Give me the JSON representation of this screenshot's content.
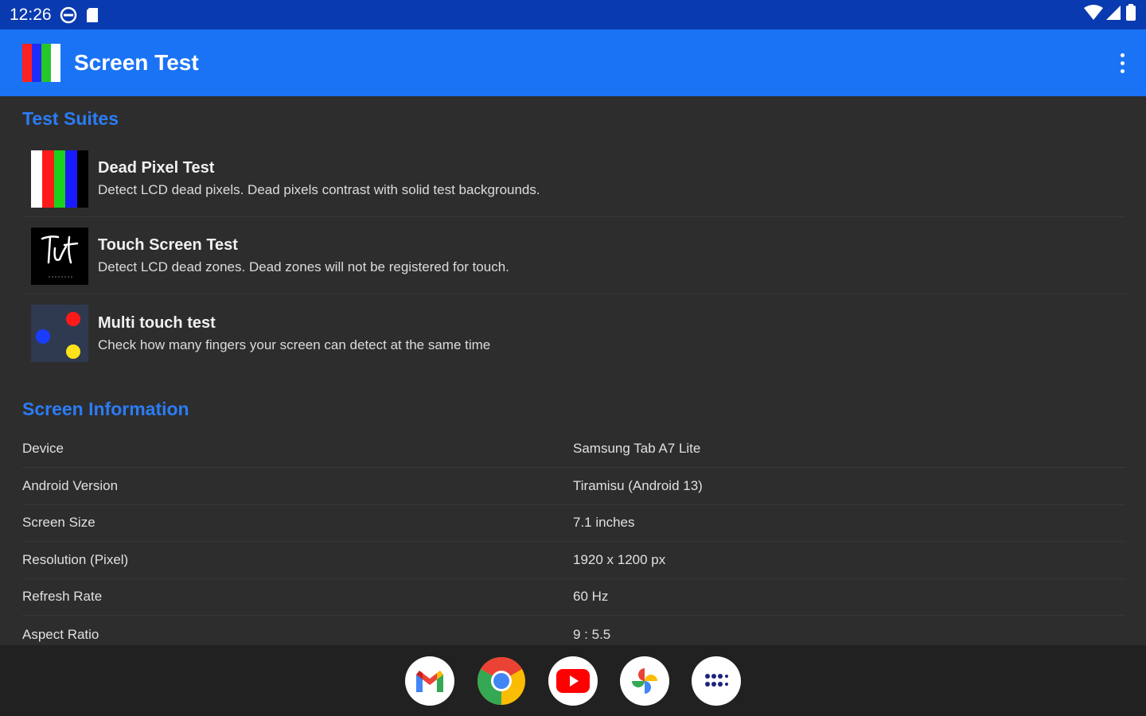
{
  "status_bar": {
    "time": "12:26"
  },
  "app_bar": {
    "title": "Screen Test"
  },
  "test_suites": {
    "title": "Test Suites",
    "items": [
      {
        "title": "Dead Pixel Test",
        "description": "Detect LCD dead pixels. Dead pixels contrast with solid test backgrounds."
      },
      {
        "title": "Touch Screen Test",
        "description": "Detect LCD dead zones. Dead zones will not be registered for touch."
      },
      {
        "title": "Multi touch test",
        "description": "Check how many fingers your screen can detect at the same time"
      }
    ]
  },
  "screen_information": {
    "title": "Screen Information",
    "rows": [
      {
        "label": "Device",
        "value": "Samsung Tab A7 Lite"
      },
      {
        "label": "Android Version",
        "value": "Tiramisu (Android 13)"
      },
      {
        "label": "Screen Size",
        "value": "7.1 inches"
      },
      {
        "label": "Resolution (Pixel)",
        "value": "1920 x 1200 px"
      },
      {
        "label": "Refresh Rate",
        "value": "60 Hz"
      },
      {
        "label": "Aspect Ratio",
        "value": "9 : 5.5"
      }
    ]
  },
  "dock": {
    "apps": [
      "gmail-icon",
      "chrome-icon",
      "youtube-icon",
      "photos-icon",
      "app-drawer-icon"
    ]
  },
  "colors": {
    "status_bar": "#0a3ab0",
    "app_bar": "#1a73f5",
    "section_title": "#2b7cf6",
    "background": "#2d2d2d"
  }
}
